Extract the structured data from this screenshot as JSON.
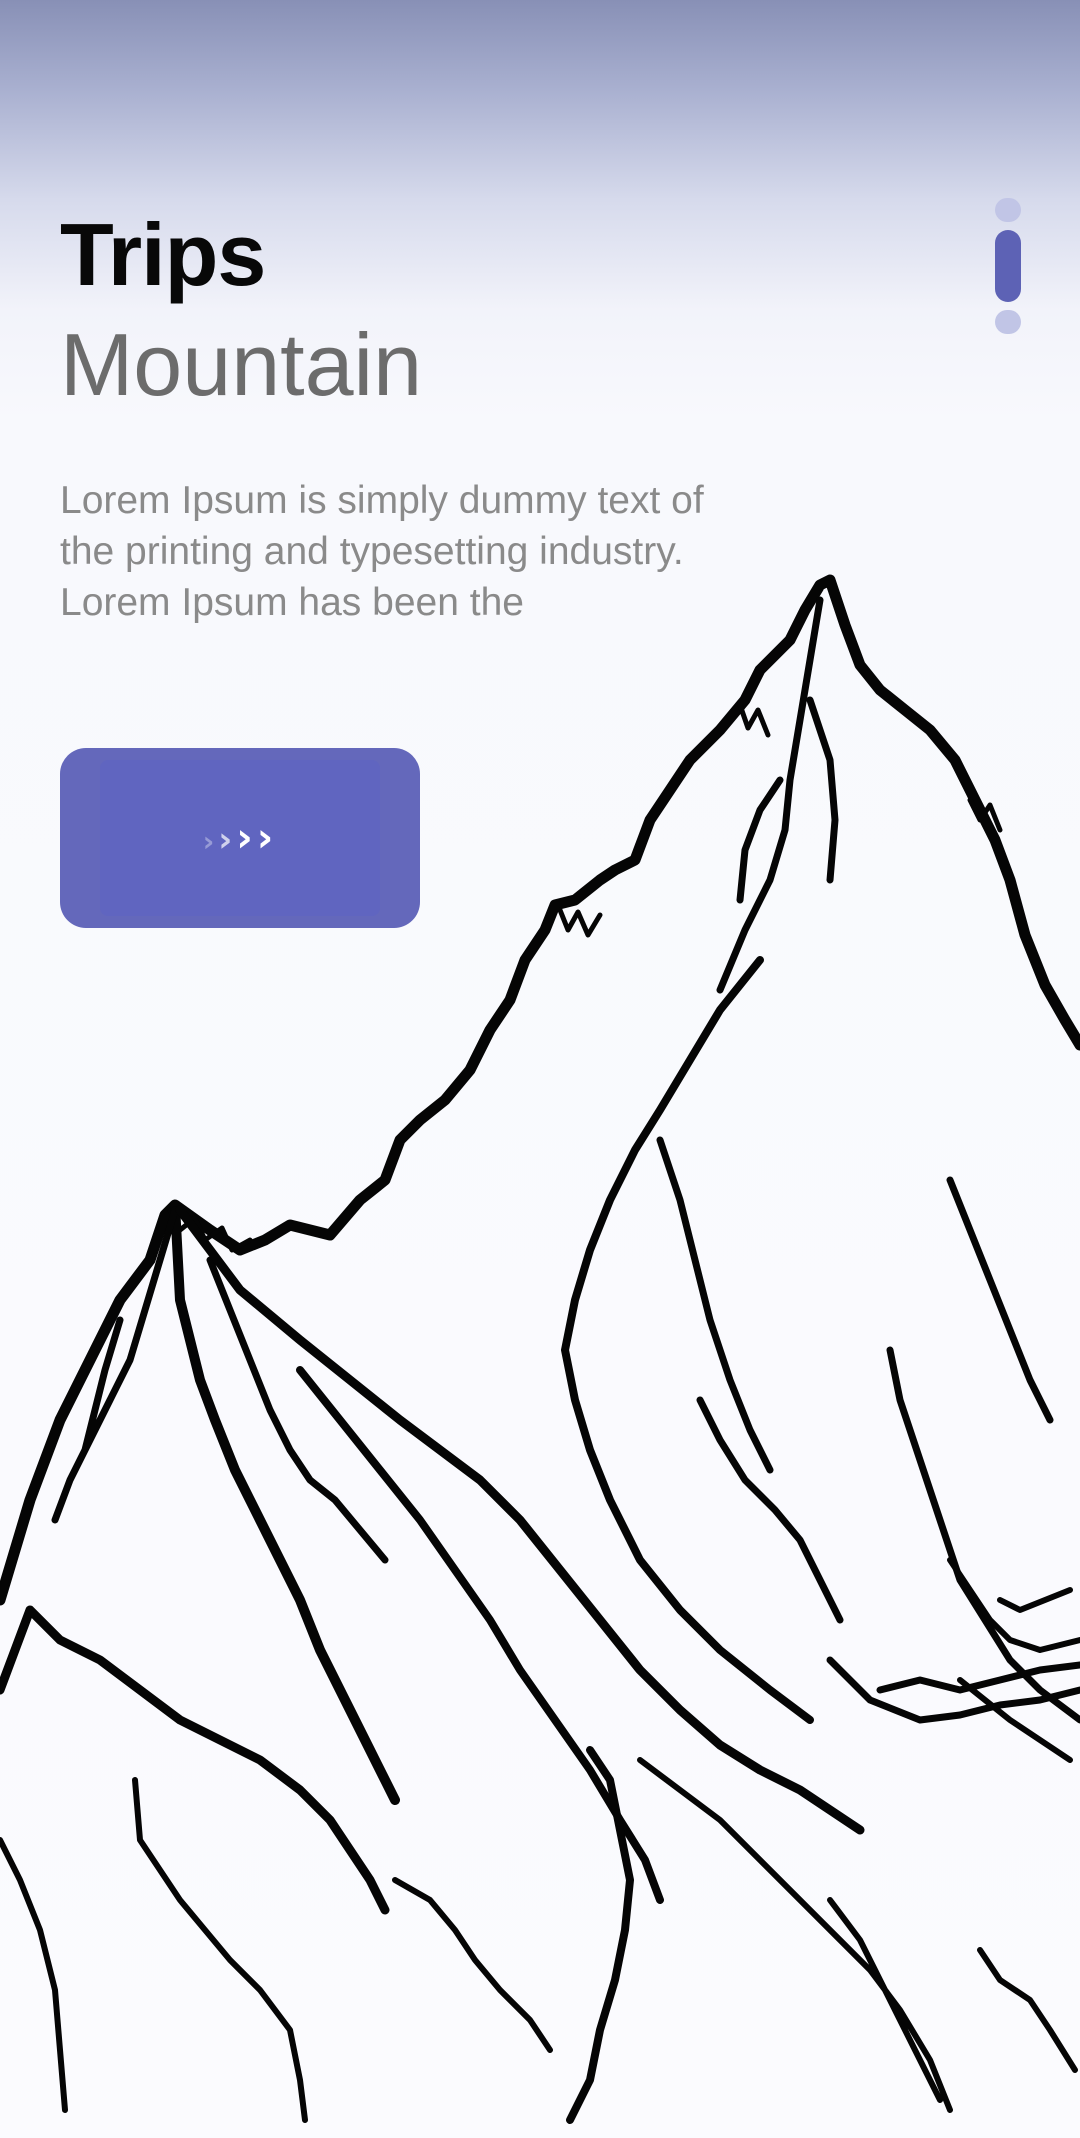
{
  "header": {
    "title": "Trips",
    "subtitle": "Mountain"
  },
  "description": "Lorem Ipsum is simply dummy text of the printing and typesetting industry. Lorem Ipsum has been the",
  "next_button": {
    "icon": "chevrons-right-icon",
    "glyphs": [
      "›",
      "›",
      "›",
      "›"
    ]
  },
  "pager": {
    "count": 3,
    "active_index": 1
  },
  "illustration": {
    "icon": "mountain-sketch-illustration"
  },
  "colors": {
    "accent": "#5d62b5",
    "button": "#6468bb",
    "title": "#080808",
    "subtitle": "#6c6c6c",
    "body_text": "#8a8a8a",
    "dot_inactive": "#c1c5e6"
  }
}
